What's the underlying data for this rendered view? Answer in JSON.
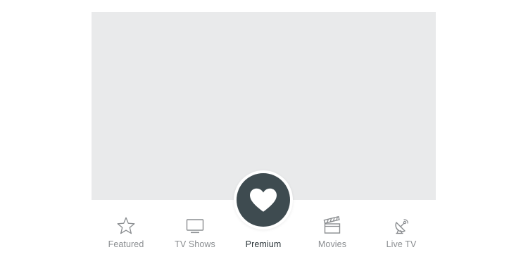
{
  "content": {
    "placeholder_color": "#e9eaeb"
  },
  "fab": {
    "icon": "heart-icon",
    "background": "#3e4b50"
  },
  "tabs": [
    {
      "label": "Featured",
      "icon": "star-icon",
      "active": false
    },
    {
      "label": "TV Shows",
      "icon": "tv-icon",
      "active": false
    },
    {
      "label": "Premium",
      "icon": "heart-icon",
      "active": true
    },
    {
      "label": "Movies",
      "icon": "clapperboard-icon",
      "active": false
    },
    {
      "label": "Live TV",
      "icon": "satellite-dish-icon",
      "active": false
    }
  ],
  "colors": {
    "inactive_label": "#8a8d90",
    "active_label": "#2c353a",
    "icon_stroke": "#8a8d90"
  }
}
